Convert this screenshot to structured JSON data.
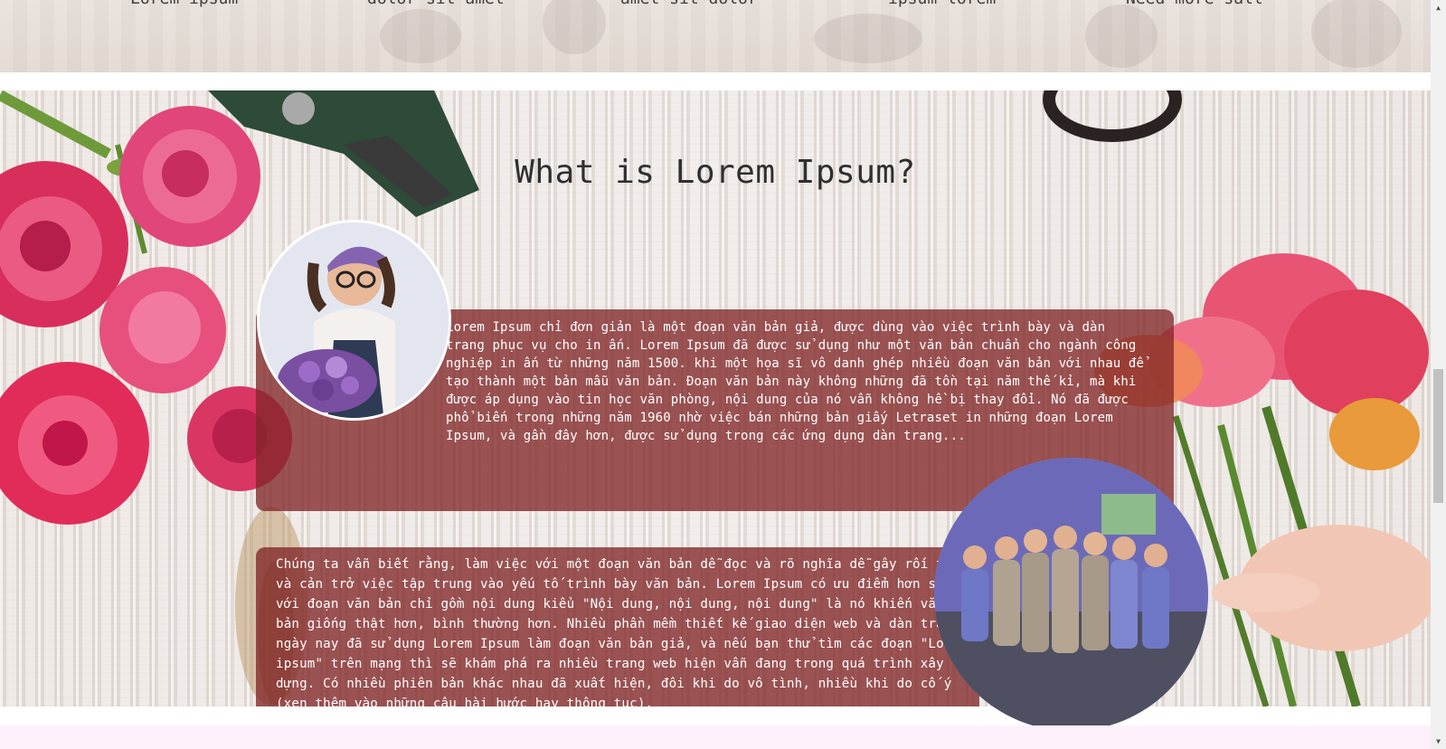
{
  "nav": {
    "items": [
      "Lorem ipsum",
      "dolor sit amet",
      "amet sit dolor",
      "ipsum lorem",
      "Need more salt"
    ]
  },
  "section": {
    "title": "What is Lorem Ipsum?",
    "card1_text": "Lorem Ipsum chỉ đơn giản là một đoạn văn bản giả, được dùng vào việc trình bày và dàn trang phục vụ cho in ấn. Lorem Ipsum đã được sử dụng như một văn bản chuẩn cho ngành công nghiệp in ấn từ những năm 1500. khi một họa sĩ vô danh ghép nhiều đoạn văn bản với nhau để tạo thành một bản mẫu văn bản. Đoạn văn bản này không những đã tồn tại năm thế kỉ, mà khi được áp dụng vào tin học văn phòng, nội dung của nó vẫn không hề bị thay đổi. Nó đã được phổ biến trong những năm 1960 nhờ việc bán những bản giấy Letraset in những đoạn Lorem Ipsum, và gần đây hơn, được sử dụng trong các ứng dụng dàn trang...",
    "card2_text": "Chúng ta vẫn biết rằng, làm việc với một đoạn văn bản dễ đọc và rõ nghĩa dễ gây rối trí và cản trở việc tập trung vào yếu tố trình bày văn bản. Lorem Ipsum có ưu điểm hơn so với đoạn văn bản chỉ gồm nội dung kiểu \"Nội dung, nội dung, nội dung\" là nó khiến văn bản giống thật hơn, bình thường hơn. Nhiều phần mềm thiết kế giao diện web và dàn trang ngày nay đã sử dụng Lorem Ipsum làm đoạn văn bản giả, và nếu bạn thử tìm các đoạn \"Lorem ipsum\" trên mạng thì sẽ khám phá ra nhiều trang web hiện vẫn đang trong quá trình xây dựng. Có nhiều phiên bản khác nhau đã xuất hiện, đôi khi do vô tình, nhiều khi do cố ý (xen thêm vào những câu hài hước hay thông tục)."
  },
  "colors": {
    "card_bg": "#822628",
    "title": "#2f2f2f",
    "bottom_strip": "#fdf0fb"
  },
  "scrollbar": {
    "up_icon": "triangle-up",
    "down_icon": "triangle-down"
  }
}
